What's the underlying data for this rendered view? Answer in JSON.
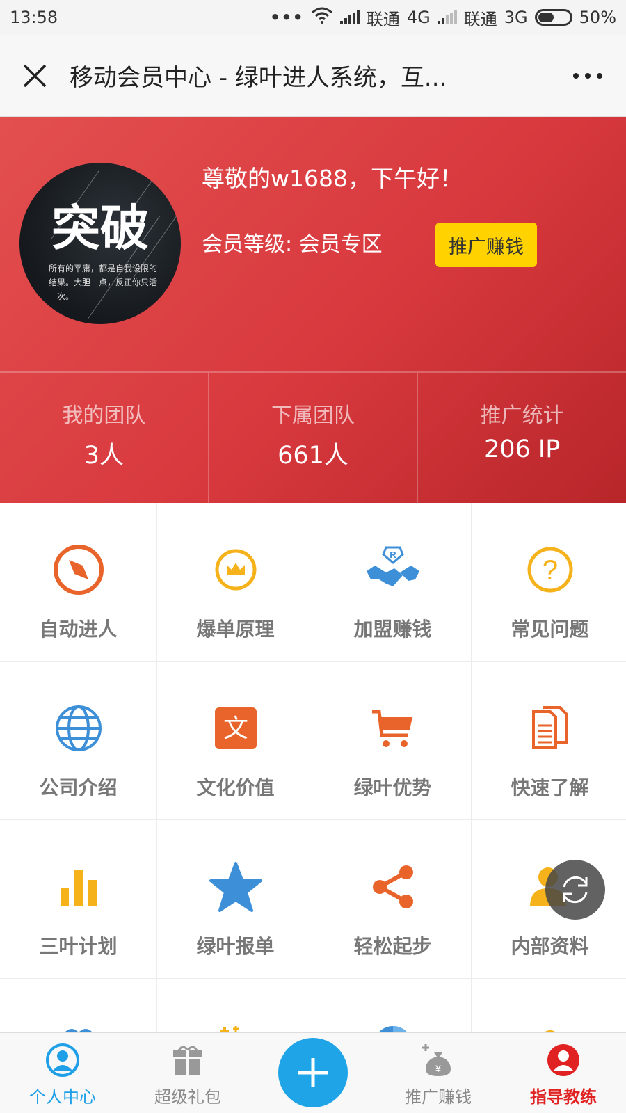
{
  "status_bar": {
    "time": "13:58",
    "dots": "•••",
    "carrier1": "联通",
    "net1": "4G",
    "carrier2": "联通",
    "net2": "3G",
    "battery": "50%"
  },
  "title_bar": {
    "title": "移动会员中心 - 绿叶进人系统，互..."
  },
  "profile": {
    "avatar_big_text": "突破",
    "avatar_small_text": "所有的平庸，都是自我设限的结果。大胆一点，反正你只活一次。",
    "greeting": "尊敬的w1688，下午好！",
    "level": "会员等级: 会员专区",
    "promo_button": "推广赚钱"
  },
  "stats": [
    {
      "label": "我的团队",
      "value": "3人"
    },
    {
      "label": "下属团队",
      "value": "661人"
    },
    {
      "label": "推广统计",
      "value": "206 IP"
    }
  ],
  "grid": [
    {
      "label": "自动进人",
      "icon": "compass-icon",
      "color": "#e8642a"
    },
    {
      "label": "爆单原理",
      "icon": "crown-icon",
      "color": "#f5b21a"
    },
    {
      "label": "加盟赚钱",
      "icon": "handshake-icon",
      "color": "#3d8fd8"
    },
    {
      "label": "常见问题",
      "icon": "question-icon",
      "color": "#f5b21a"
    },
    {
      "label": "公司介绍",
      "icon": "globe-icon",
      "color": "#3d8fd8"
    },
    {
      "label": "文化价值",
      "icon": "wen-icon",
      "color": "#e8642a"
    },
    {
      "label": "绿叶优势",
      "icon": "cart-icon",
      "color": "#e8642a"
    },
    {
      "label": "快速了解",
      "icon": "document-icon",
      "color": "#e8642a"
    },
    {
      "label": "三叶计划",
      "icon": "bar-chart-icon",
      "color": "#f5b21a"
    },
    {
      "label": "绿叶报单",
      "icon": "star-icon",
      "color": "#3d8fd8"
    },
    {
      "label": "轻松起步",
      "icon": "share-icon",
      "color": "#e8642a"
    },
    {
      "label": "内部资料",
      "icon": "users-icon",
      "color": "#f5b21a"
    }
  ],
  "bottom_nav": [
    {
      "label": "个人中心",
      "icon": "user-circle-icon"
    },
    {
      "label": "超级礼包",
      "icon": "gift-icon"
    },
    {
      "label": "推广赚钱",
      "icon": "money-bag-icon"
    },
    {
      "label": "指导教练",
      "icon": "coach-icon"
    }
  ],
  "colors": {
    "header_red": "#d8393e",
    "accent_blue": "#1fa4e8",
    "button_yellow": "#ffd200",
    "coach_red": "#e02222"
  }
}
